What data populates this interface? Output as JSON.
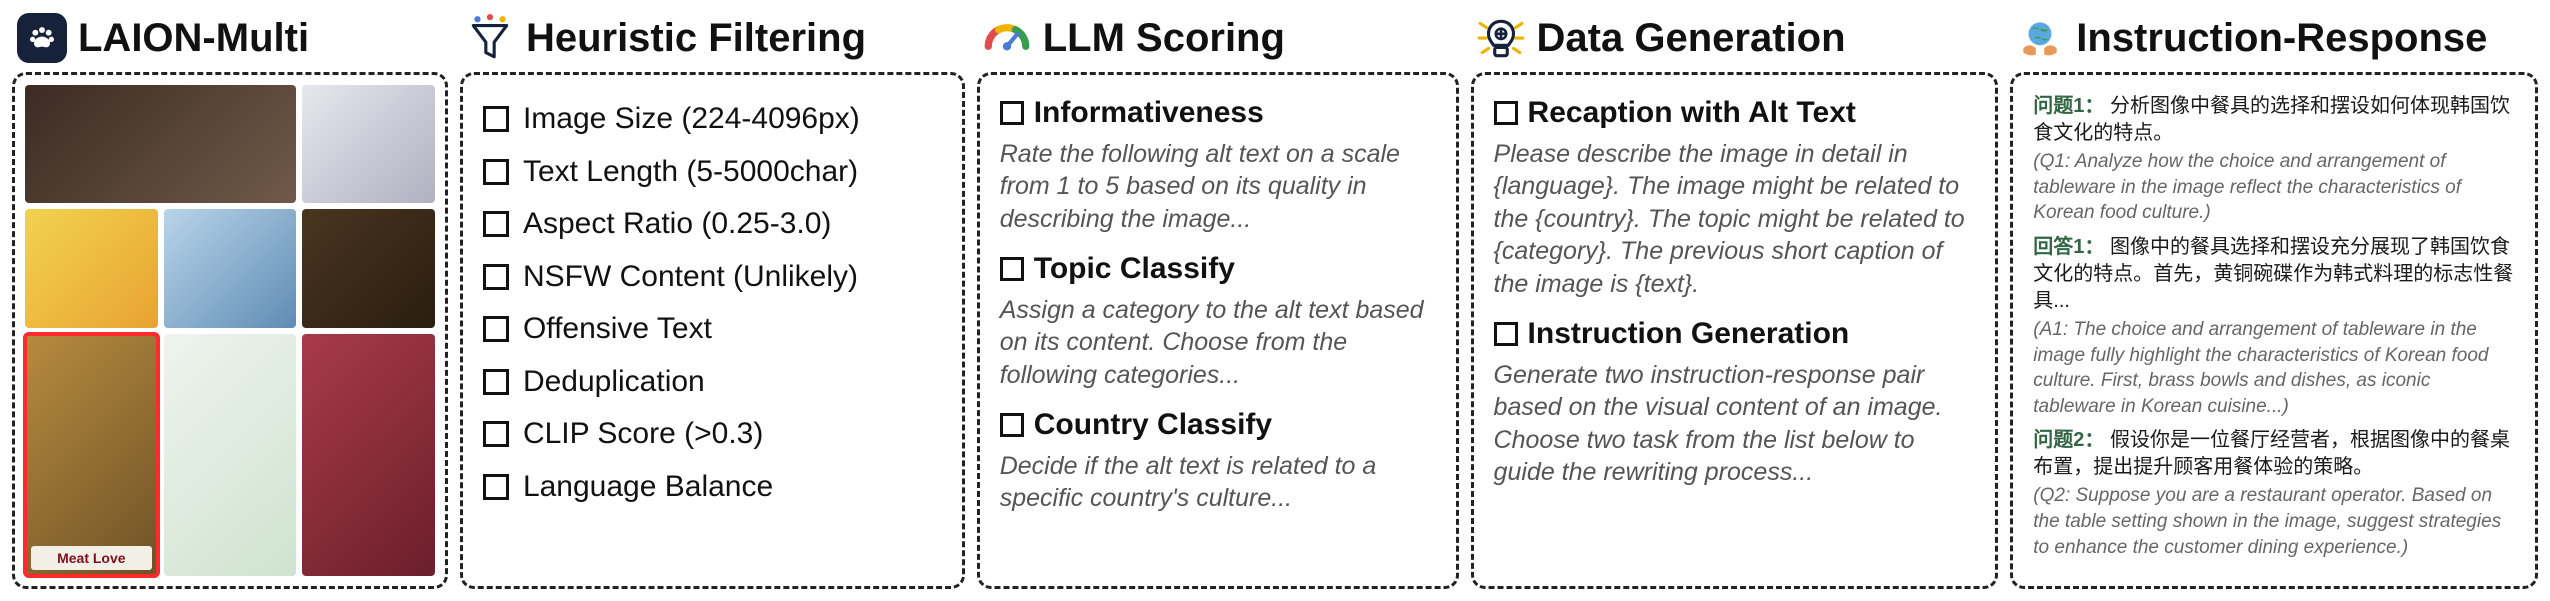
{
  "stages": {
    "laion": {
      "title": "LAION-Multi",
      "highlight_label": "Meat Love"
    },
    "filter": {
      "title": "Heuristic Filtering",
      "items": [
        "Image Size (224-4096px)",
        "Text Length (5-5000char)",
        "Aspect Ratio (0.25-3.0)",
        "NSFW Content (Unlikely)",
        "Offensive Text",
        "Deduplication",
        "CLIP Score (>0.3)",
        "Language Balance"
      ]
    },
    "scoring": {
      "title": "LLM Scoring",
      "sections": [
        {
          "head": "Informativeness",
          "desc": "Rate the following alt text on a scale from 1 to 5 based on its quality in describing the image..."
        },
        {
          "head": "Topic Classify",
          "desc": "Assign a category to the alt text based on its content. Choose from the following categories..."
        },
        {
          "head": "Country Classify",
          "desc": "Decide if the alt text is related to a specific country's culture..."
        }
      ]
    },
    "generation": {
      "title": "Data Generation",
      "sections": [
        {
          "head": "Recaption with Alt Text",
          "desc": "Please describe the image in detail in {language}. The image might be related to the {country}. The topic might be related to {category}. The previous short caption of the image is {text}."
        },
        {
          "head": "Instruction Generation",
          "desc": "Generate two instruction-response pair based on the visual content of an image. Choose two task from the list below to guide the rewriting process..."
        }
      ]
    },
    "ir": {
      "title": "Instruction-Response",
      "q1_label": "问题1：",
      "q1_text": "分析图像中餐具的选择和摆设如何体现韩国饮食文化的特点。",
      "q1_trans": "(Q1: Analyze how the choice and arrangement of tableware in the image reflect the characteristics of Korean food culture.)",
      "a1_label": "回答1：",
      "a1_text": "图像中的餐具选择和摆设充分展现了韩国饮食文化的特点。首先，黄铜碗碟作为韩式料理的标志性餐具...",
      "a1_trans": "(A1: The choice and arrangement of tableware in the image fully highlight the characteristics of Korean food culture. First, brass bowls and dishes, as iconic tableware in Korean cuisine...)",
      "q2_label": "问题2：",
      "q2_text": "假设你是一位餐厅经营者，根据图像中的餐桌布置，提出提升顾客用餐体验的策略。",
      "q2_trans": "(Q2: Suppose you are a restaurant operator. Based on the table setting shown in the image, suggest strategies to enhance the customer dining experience.)"
    }
  }
}
